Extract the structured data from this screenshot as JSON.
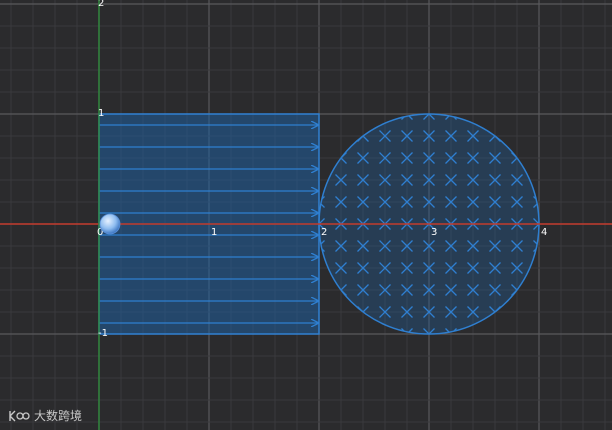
{
  "colors": {
    "background": "#2b2b2d",
    "grid_minor": "#3a3a3d",
    "grid_major": "#59595c",
    "x_axis": "#c0392b",
    "y_axis": "#2e8b3d",
    "field": "#2f7fd0",
    "field_fill": "#1f5f9e",
    "particle": "#8fbdf0"
  },
  "axes": {
    "x_range": [
      -0.9,
      4.65
    ],
    "y_range": [
      -1.85,
      2.05
    ],
    "x_ticks": [
      "1",
      "2",
      "3",
      "4"
    ],
    "y_ticks": [
      "2",
      "1",
      "-1"
    ],
    "origin_label": "0"
  },
  "electric_field": {
    "x_range": [
      0,
      2
    ],
    "y_range": [
      -1,
      1
    ],
    "direction": "+x",
    "arrow_rows": 10
  },
  "magnetic_field": {
    "center": [
      3,
      0
    ],
    "radius": 1,
    "direction": "into-page",
    "symbol": "×"
  },
  "particle": {
    "position": [
      0.1,
      0
    ]
  },
  "watermark": {
    "text": "大数跨境",
    "icon": "dashu-logo-icon"
  }
}
